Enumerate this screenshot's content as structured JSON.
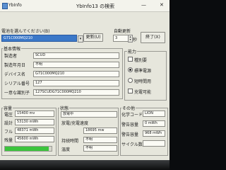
{
  "window": {
    "title": "YbInfo13 の検索",
    "app_label": "YbInfo",
    "min": "—",
    "close": "✕"
  },
  "battery_select": {
    "label": "電池を選んでください(B)",
    "value": "G71C000MQ210",
    "update_button": "更新(U)"
  },
  "auto_update": {
    "label": "自動更新",
    "value": "3",
    "unit": "秒",
    "exit_button": "終了(X)"
  },
  "basic_info": {
    "title": "基本情報",
    "rows": [
      {
        "label": "製造者",
        "value": "SCUD"
      },
      {
        "label": "製造年月日",
        "value": "不明"
      },
      {
        "label": "デバイス名",
        "value": "G71C000MQ210"
      },
      {
        "label": "シリアル番号",
        "value": "127"
      },
      {
        "label": "一意な識別子",
        "value": "127SCUDG71C000MQ210"
      }
    ]
  },
  "capability": {
    "title": "能力",
    "options": [
      {
        "label": "種別要",
        "kind": "check",
        "checked": false
      },
      {
        "label": "標準電源",
        "kind": "radio",
        "checked": true
      },
      {
        "label": "短時間用",
        "kind": "radio",
        "checked": false
      },
      {
        "label": "充電可能",
        "kind": "check",
        "checked": false
      }
    ]
  },
  "capacity": {
    "title": "容量",
    "rows": [
      {
        "label": "電圧",
        "value": "15400 mv"
      },
      {
        "label": "設計",
        "value": "53130 mWh"
      },
      {
        "label": "フル",
        "value": "48371 mWh"
      },
      {
        "label": "残量",
        "value": "45600 mWh"
      }
    ],
    "level_fraction": 0.94,
    "level_color": "#3cc43c"
  },
  "status": {
    "title": "状態",
    "charge_state": "放電中",
    "charge_rate_label": "放電/充電速度",
    "charge_rate_value": "18695 mw",
    "remaining_label": "持続時間",
    "remaining_value": "不明",
    "temp_label": "温度",
    "temp_value": "不明"
  },
  "other": {
    "title": "その他",
    "rows": [
      {
        "label": "化学コード",
        "value": "LION"
      },
      {
        "label": "警告容量",
        "value": "0 mWh"
      },
      {
        "label": "警告容量",
        "value": "968 mWh"
      },
      {
        "label": "サイクル数",
        "value": ""
      }
    ]
  }
}
